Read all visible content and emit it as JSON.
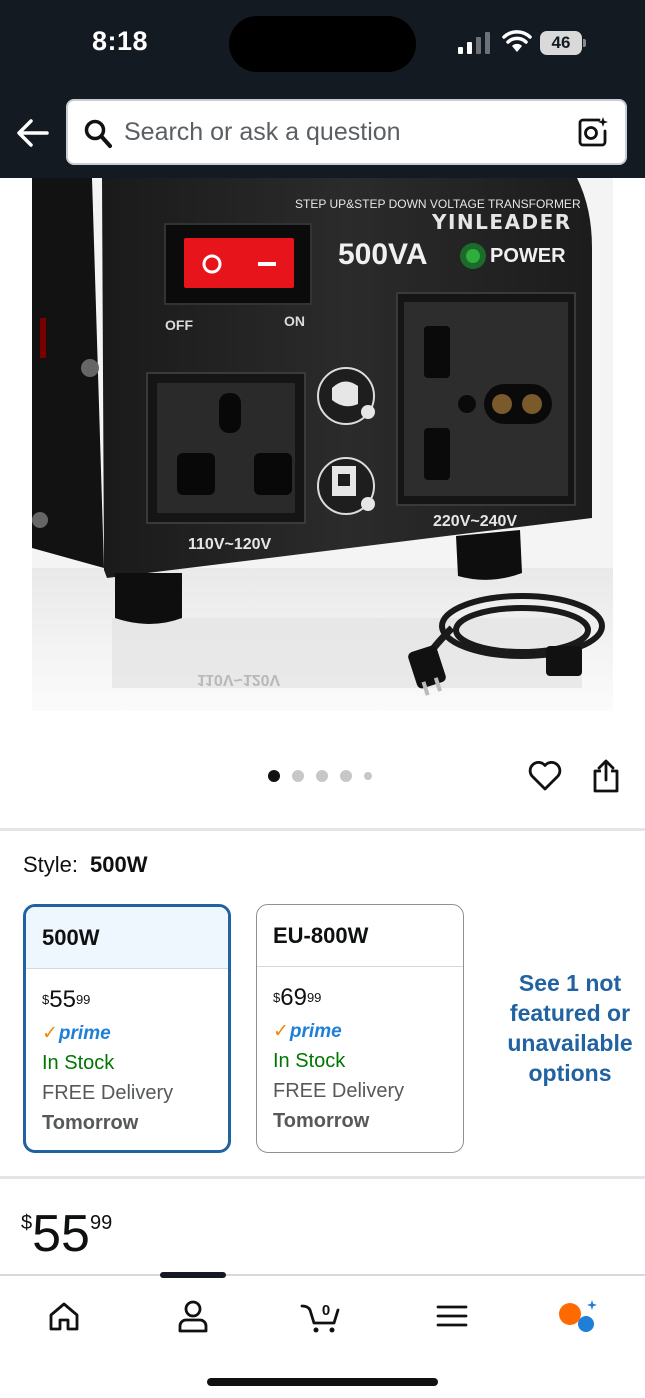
{
  "status_bar": {
    "time": "8:18",
    "battery": "46"
  },
  "search": {
    "placeholder": "Search or ask a question"
  },
  "product_image": {
    "banner": "STEP UP&STEP DOWN VOLTAGE TRANSFORMER",
    "brand": "YINLEADER",
    "rating": "500VA",
    "power_label": "POWER",
    "switch_off": "OFF",
    "switch_on": "ON",
    "left_outlet_label": "110V~120V",
    "right_outlet_label": "220V~240V",
    "reflection_label": "110V~120V"
  },
  "carousel": {
    "total_dots": 5,
    "active_index": 0
  },
  "style": {
    "label": "Style:",
    "selected_value": "500W",
    "options": [
      {
        "name": "500W",
        "price_symbol": "$",
        "price_whole": "55",
        "price_fraction": "99",
        "prime_label": "prime",
        "stock": "In Stock",
        "delivery": "FREE Delivery",
        "delivery_day": "Tomorrow",
        "selected": true
      },
      {
        "name": "EU-800W",
        "price_symbol": "$",
        "price_whole": "69",
        "price_fraction": "99",
        "prime_label": "prime",
        "stock": "In Stock",
        "delivery": "FREE Delivery",
        "delivery_day": "Tomorrow",
        "selected": false
      }
    ],
    "see_more": "See 1 not featured or unavailable options"
  },
  "price": {
    "symbol": "$",
    "whole": "55",
    "fraction": "99"
  },
  "bottom_nav": {
    "items": [
      "home-icon",
      "account-icon",
      "cart-icon",
      "menu-icon",
      "rufus-icon"
    ],
    "cart_count": "0",
    "accent_color": "#ff6a00"
  },
  "colors": {
    "header_bg": "#131a22",
    "link": "#2162a1",
    "in_stock": "#007600",
    "prime_blue": "#1f7fd8"
  }
}
